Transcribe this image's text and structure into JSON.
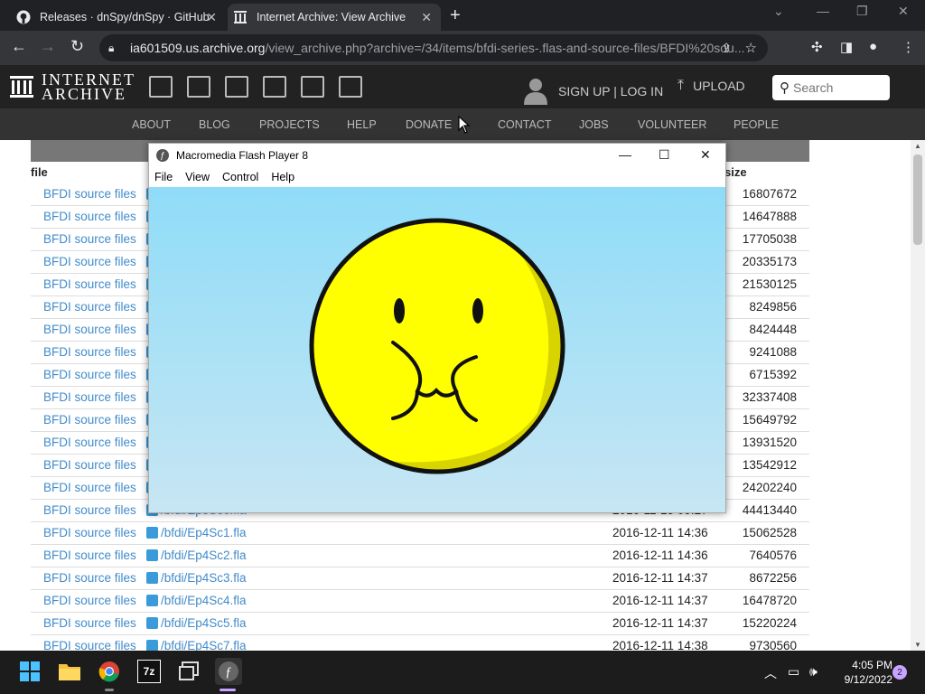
{
  "browser": {
    "tabs": [
      {
        "title": "Releases · dnSpy/dnSpy · GitHub",
        "icon": "github-icon"
      },
      {
        "title": "Internet Archive: View Archive",
        "icon": "archive-icon"
      }
    ],
    "url_host": "ia601509.us.archive.org",
    "url_path": "/view_archive.php?archive=/34/items/bfdi-series-.flas-and-source-files/BFDI%20sou..."
  },
  "ia": {
    "logo_line1": "INTERNET",
    "logo_line2": "ARCHIVE",
    "signin": "SIGN UP | LOG IN",
    "upload": "UPLOAD",
    "search_placeholder": "Search",
    "nav": [
      "ABOUT",
      "BLOG",
      "PROJECTS",
      "HELP",
      "DONATE",
      "CONTACT",
      "JOBS",
      "VOLUNTEER",
      "PEOPLE"
    ]
  },
  "table": {
    "col_file": "file",
    "col_size": "size",
    "rows": [
      {
        "src": "BFDI source files",
        "file": "",
        "date": "",
        "size": "16807672"
      },
      {
        "src": "BFDI source files",
        "file": "",
        "date": "",
        "size": "14647888"
      },
      {
        "src": "BFDI source files",
        "file": "",
        "date": "",
        "size": "17705038"
      },
      {
        "src": "BFDI source files",
        "file": "",
        "date": "",
        "size": "20335173"
      },
      {
        "src": "BFDI source files",
        "file": "",
        "date": "",
        "size": "21530125"
      },
      {
        "src": "BFDI source files",
        "file": "",
        "date": "",
        "size": "8249856"
      },
      {
        "src": "BFDI source files",
        "file": "",
        "date": "",
        "size": "8424448"
      },
      {
        "src": "BFDI source files",
        "file": "",
        "date": "",
        "size": "9241088"
      },
      {
        "src": "BFDI source files",
        "file": "",
        "date": "",
        "size": "6715392"
      },
      {
        "src": "BFDI source files",
        "file": "",
        "date": "",
        "size": "32337408"
      },
      {
        "src": "BFDI source files",
        "file": "",
        "date": "",
        "size": "15649792"
      },
      {
        "src": "BFDI source files",
        "file": "",
        "date": "",
        "size": "13931520"
      },
      {
        "src": "BFDI source files",
        "file": "",
        "date": "",
        "size": "13542912"
      },
      {
        "src": "BFDI source files",
        "file": "",
        "date": "",
        "size": "24202240"
      },
      {
        "src": "BFDI source files",
        "file": "/bfdi/Ep3Sc6.fla",
        "date": "2016-11-15 09:27",
        "size": "44413440"
      },
      {
        "src": "BFDI source files",
        "file": "/bfdi/Ep4Sc1.fla",
        "date": "2016-12-11 14:36",
        "size": "15062528"
      },
      {
        "src": "BFDI source files",
        "file": "/bfdi/Ep4Sc2.fla",
        "date": "2016-12-11 14:36",
        "size": "7640576"
      },
      {
        "src": "BFDI source files",
        "file": "/bfdi/Ep4Sc3.fla",
        "date": "2016-12-11 14:37",
        "size": "8672256"
      },
      {
        "src": "BFDI source files",
        "file": "/bfdi/Ep4Sc4.fla",
        "date": "2016-12-11 14:37",
        "size": "16478720"
      },
      {
        "src": "BFDI source files",
        "file": "/bfdi/Ep4Sc5.fla",
        "date": "2016-12-11 14:37",
        "size": "15220224"
      },
      {
        "src": "BFDI source files",
        "file": "/bfdi/Ep4Sc7.fla",
        "date": "2016-12-11 14:38",
        "size": "9730560"
      }
    ]
  },
  "flash": {
    "title": "Macromedia Flash Player 8",
    "menu": [
      "File",
      "View",
      "Control",
      "Help"
    ],
    "colors": {
      "sky_top": "#8fdcf8",
      "face": "#ffff00",
      "shade": "#d7d400"
    }
  },
  "taskbar": {
    "time": "4:05 PM",
    "date": "9/12/2022",
    "notifications": "2",
    "apps": [
      "windows-start-icon",
      "file-explorer-icon",
      "chrome-icon",
      "7zip-icon",
      "task-view-icon",
      "flash-player-icon"
    ]
  }
}
